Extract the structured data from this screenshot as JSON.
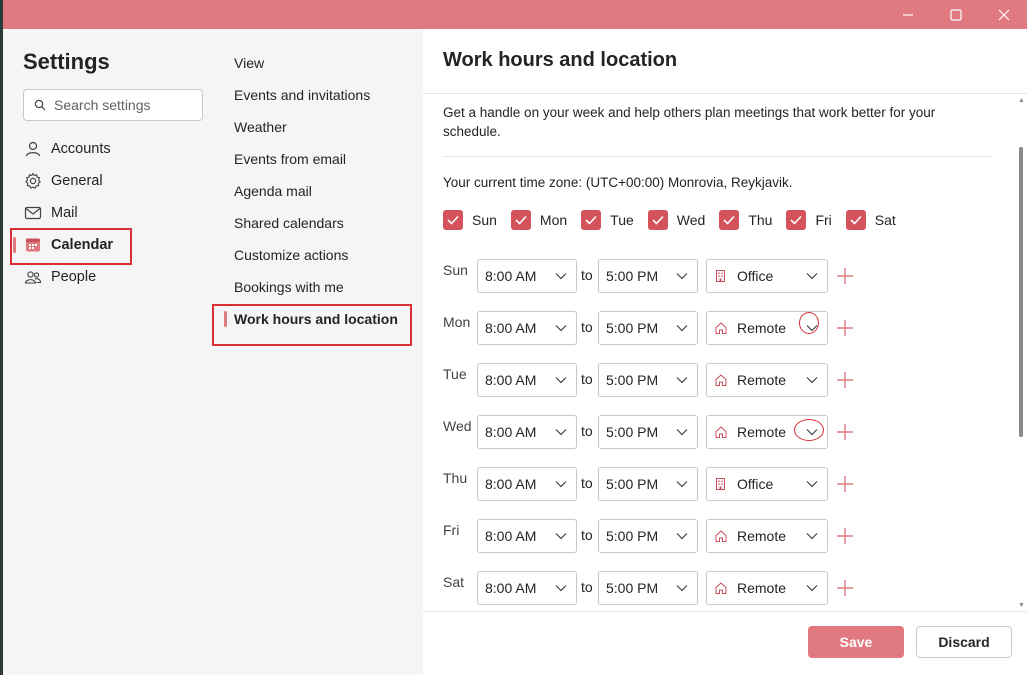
{
  "window": {
    "controls": {
      "minimize": "—",
      "maximize": "☐",
      "close": "✕"
    }
  },
  "nav": {
    "title": "Settings",
    "search_placeholder": "Search settings",
    "categories": [
      {
        "label": "Accounts",
        "icon": "person-icon"
      },
      {
        "label": "General",
        "icon": "gear-icon"
      },
      {
        "label": "Mail",
        "icon": "mail-icon"
      },
      {
        "label": "Calendar",
        "icon": "calendar-icon",
        "active": true
      },
      {
        "label": "People",
        "icon": "people-icon"
      }
    ]
  },
  "subnav": {
    "items": [
      {
        "label": "View"
      },
      {
        "label": "Events and invitations"
      },
      {
        "label": "Weather"
      },
      {
        "label": "Events from email"
      },
      {
        "label": "Agenda mail"
      },
      {
        "label": "Shared calendars"
      },
      {
        "label": "Customize actions"
      },
      {
        "label": "Bookings with me"
      },
      {
        "label": "Work hours and location",
        "active": true
      }
    ]
  },
  "content": {
    "title": "Work hours and location",
    "description": "Get a handle on your week and help others plan meetings that work better for your schedule.",
    "timezone": "Your current time zone: (UTC+00:00) Monrovia, Reykjavik.",
    "days": [
      {
        "label": "Sun",
        "checked": true
      },
      {
        "label": "Mon",
        "checked": true
      },
      {
        "label": "Tue",
        "checked": true
      },
      {
        "label": "Wed",
        "checked": true
      },
      {
        "label": "Thu",
        "checked": true
      },
      {
        "label": "Fri",
        "checked": true
      },
      {
        "label": "Sat",
        "checked": true
      }
    ],
    "to_label": "to",
    "schedule": [
      {
        "day": "Sun",
        "start": "8:00 AM",
        "end": "5:00 PM",
        "location": "Office",
        "location_icon": "building-icon"
      },
      {
        "day": "Mon",
        "start": "8:00 AM",
        "end": "5:00 PM",
        "location": "Remote",
        "location_icon": "home-icon"
      },
      {
        "day": "Tue",
        "start": "8:00 AM",
        "end": "5:00 PM",
        "location": "Remote",
        "location_icon": "home-icon"
      },
      {
        "day": "Wed",
        "start": "8:00 AM",
        "end": "5:00 PM",
        "location": "Remote",
        "location_icon": "home-icon"
      },
      {
        "day": "Thu",
        "start": "8:00 AM",
        "end": "5:00 PM",
        "location": "Office",
        "location_icon": "building-icon"
      },
      {
        "day": "Fri",
        "start": "8:00 AM",
        "end": "5:00 PM",
        "location": "Remote",
        "location_icon": "home-icon"
      },
      {
        "day": "Sat",
        "start": "8:00 AM",
        "end": "5:00 PM",
        "location": "Remote",
        "location_icon": "home-icon"
      }
    ]
  },
  "footer": {
    "save_label": "Save",
    "discard_label": "Discard"
  },
  "colors": {
    "accent": "#e07a80",
    "checkbox": "#d3525c",
    "annotation": "#d93036"
  }
}
